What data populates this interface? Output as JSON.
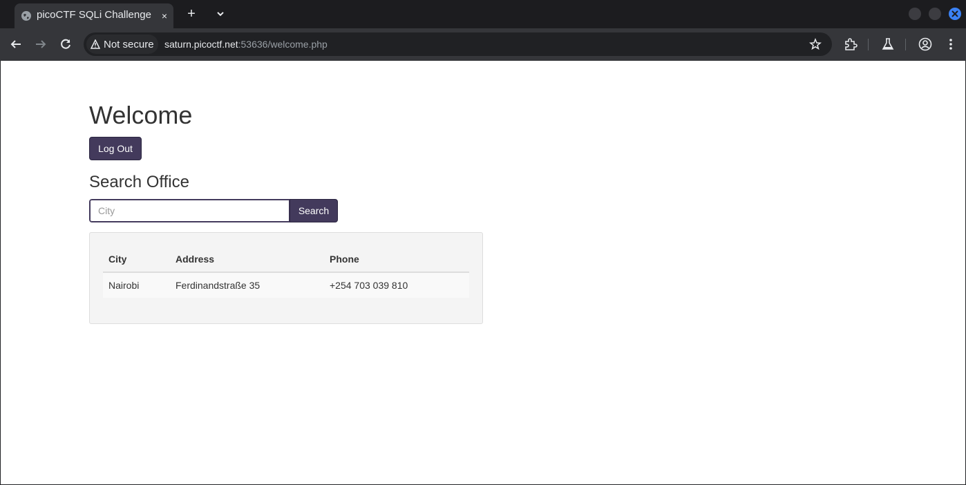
{
  "browser": {
    "tab": {
      "title": "picoCTF SQLi Challenge",
      "close_label": "×"
    },
    "newtab_label": "+",
    "security_label": "Not secure",
    "url_host": "saturn.picoctf.net",
    "url_rest": ":53636/welcome.php",
    "icons": [
      "globe-icon",
      "close-icon",
      "plus-icon",
      "chevron-down-icon",
      "back-icon",
      "forward-icon",
      "reload-icon",
      "warning-icon",
      "star-icon",
      "extension-icon",
      "lab-icon",
      "profile-icon",
      "more-vert-icon"
    ],
    "colors": {
      "frame": "#1c1c1f",
      "toolbar": "#35363a",
      "omnibox": "#202124",
      "close_button": "#3b82f6"
    }
  },
  "page": {
    "heading": "Welcome",
    "logout_label": "Log Out",
    "search_heading": "Search Office",
    "search_input": {
      "placeholder": "City",
      "value": ""
    },
    "search_button_label": "Search",
    "table": {
      "headers": [
        "City",
        "Address",
        "Phone"
      ],
      "rows": [
        [
          "Nairobi",
          "Ferdinandstraße 35",
          "+254 703 039 810"
        ]
      ]
    },
    "colors": {
      "accent": "#433a5c",
      "text": "#333333",
      "panel": "#f4f4f4"
    }
  }
}
